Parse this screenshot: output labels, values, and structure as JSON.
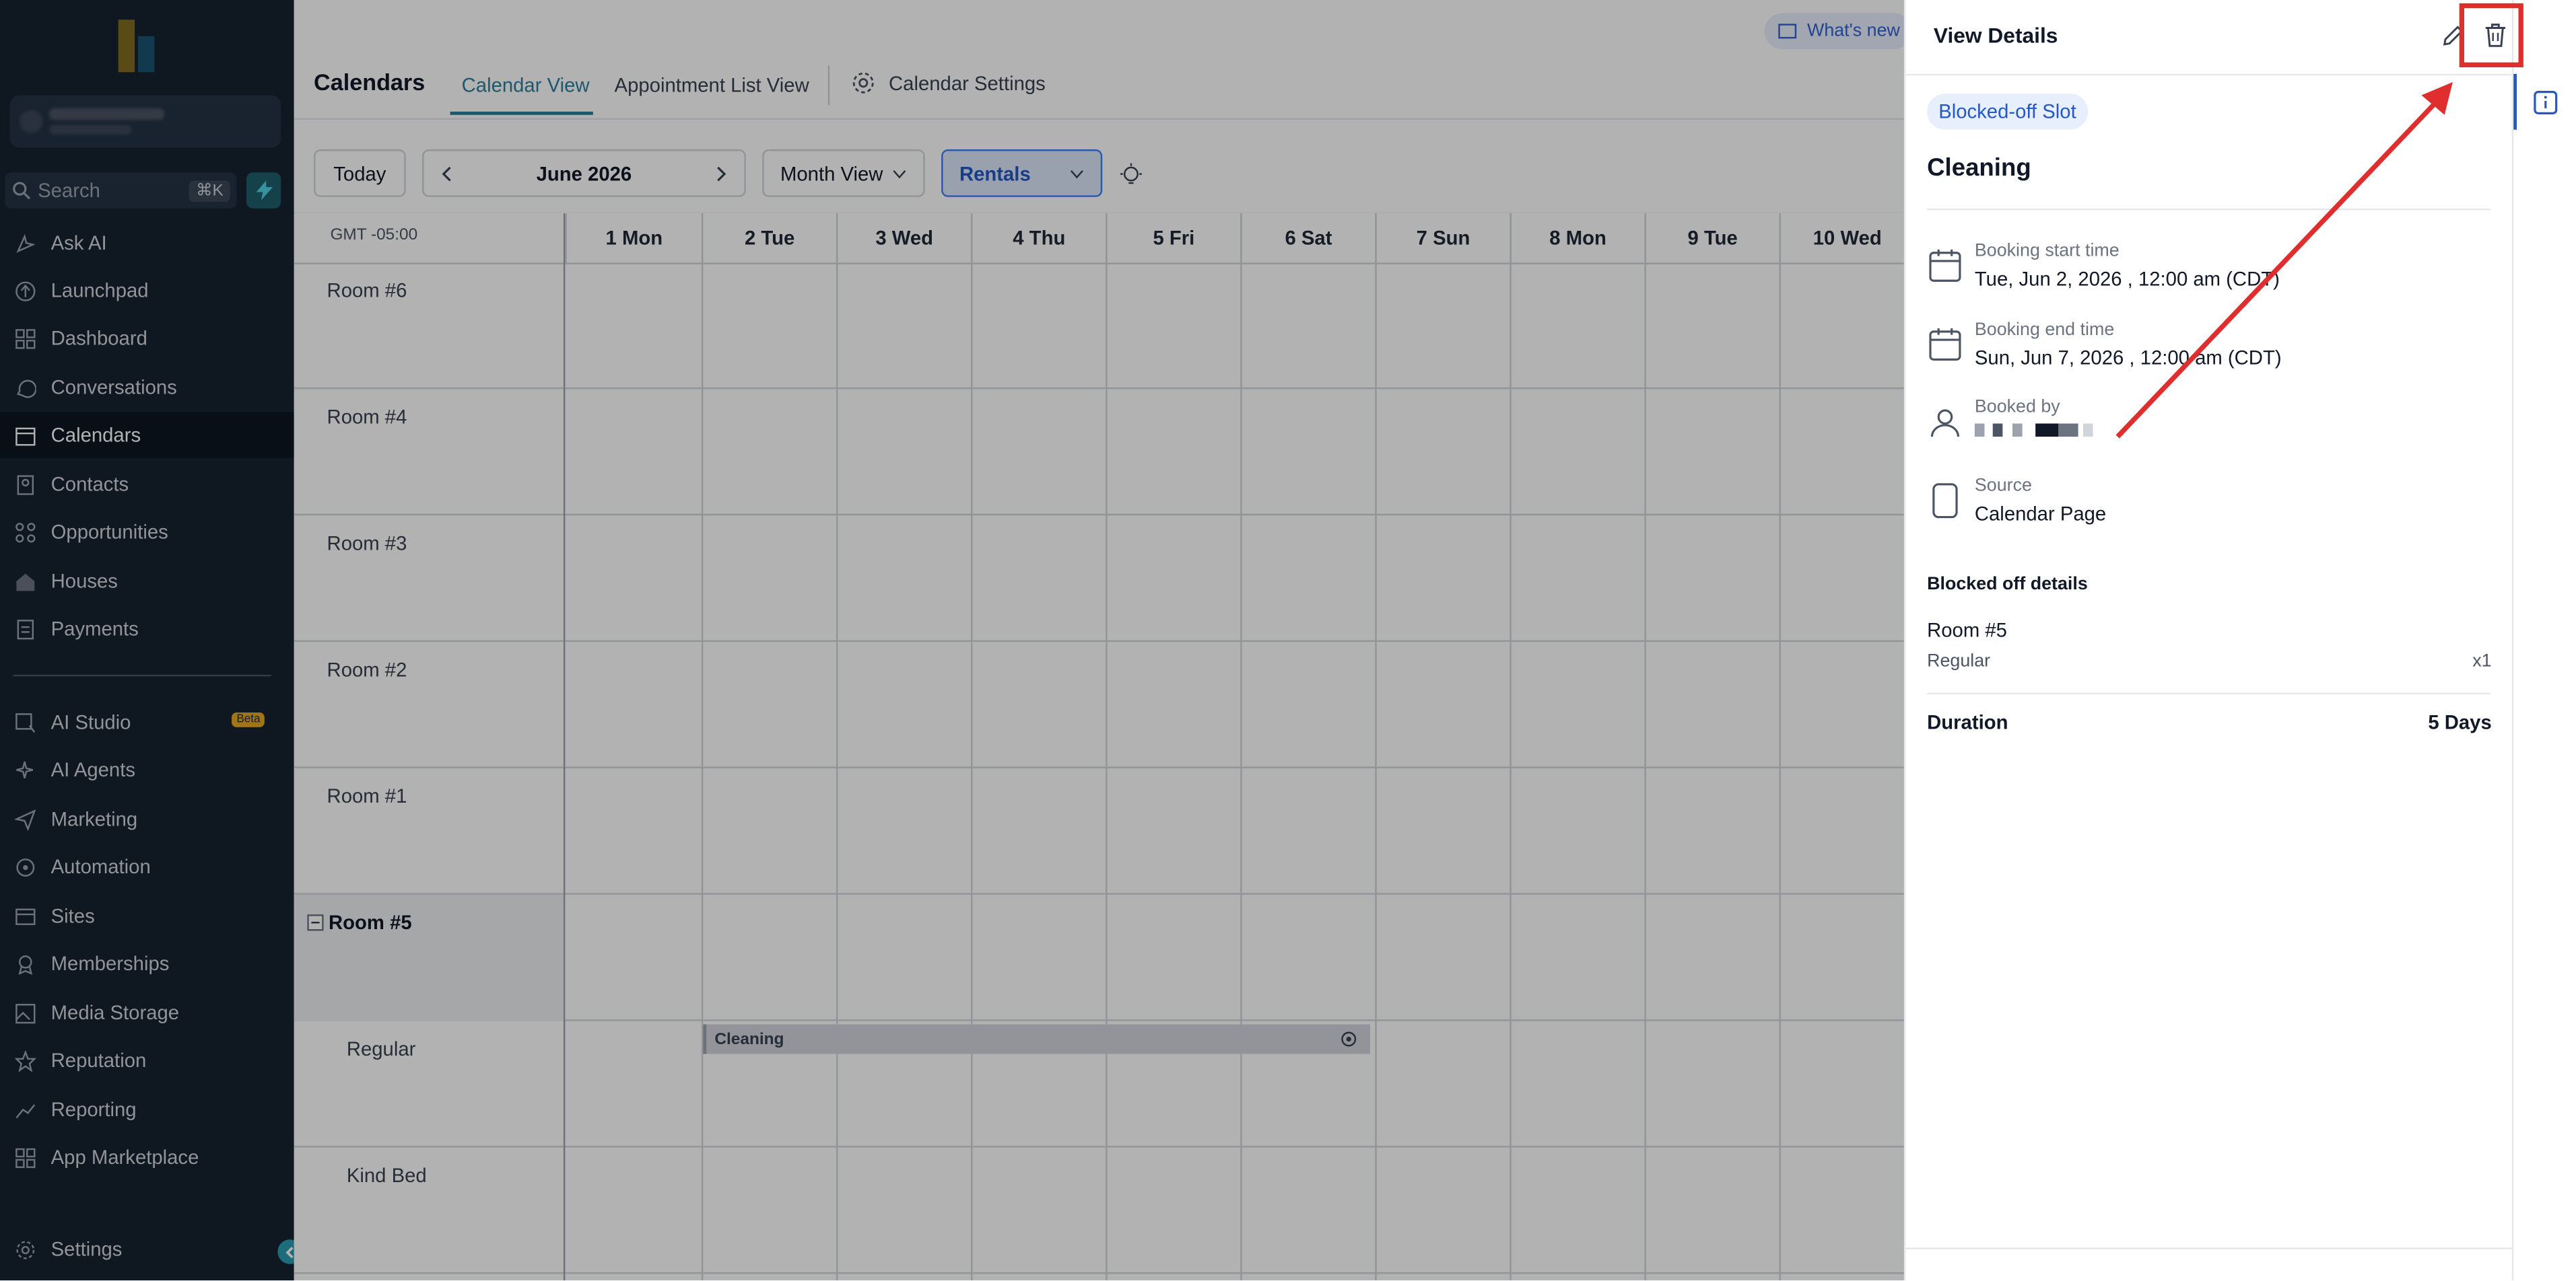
{
  "sidebar": {
    "search": {
      "placeholder": "Search",
      "shortcut": "⌘K"
    },
    "items": [
      {
        "label": "Ask AI",
        "icon": "ask-ai-icon"
      },
      {
        "label": "Launchpad",
        "icon": "launchpad-icon"
      },
      {
        "label": "Dashboard",
        "icon": "dashboard-icon"
      },
      {
        "label": "Conversations",
        "icon": "chat-icon"
      },
      {
        "label": "Calendars",
        "icon": "calendar-icon",
        "active": true
      },
      {
        "label": "Contacts",
        "icon": "contacts-icon"
      },
      {
        "label": "Opportunities",
        "icon": "opportunities-icon"
      },
      {
        "label": "Houses",
        "icon": "house-icon"
      },
      {
        "label": "Payments",
        "icon": "payments-icon"
      },
      {
        "label": "AI Studio",
        "icon": "ai-studio-icon",
        "badge": "Beta"
      },
      {
        "label": "AI Agents",
        "icon": "ai-agents-icon"
      },
      {
        "label": "Marketing",
        "icon": "marketing-icon"
      },
      {
        "label": "Automation",
        "icon": "automation-icon"
      },
      {
        "label": "Sites",
        "icon": "sites-icon"
      },
      {
        "label": "Memberships",
        "icon": "memberships-icon"
      },
      {
        "label": "Media Storage",
        "icon": "media-icon"
      },
      {
        "label": "Reputation",
        "icon": "reputation-icon"
      },
      {
        "label": "Reporting",
        "icon": "reporting-icon"
      },
      {
        "label": "App Marketplace",
        "icon": "marketplace-icon"
      },
      {
        "label": "Settings",
        "icon": "gear-icon"
      }
    ]
  },
  "header": {
    "title": "Calendars",
    "tabs": [
      "Calendar View",
      "Appointment List View",
      "Calendar Settings"
    ],
    "whats_new": "What's new"
  },
  "toolbar": {
    "today": "Today",
    "month_label": "June 2026",
    "view": "Month View",
    "calendar": "Rentals"
  },
  "calendar": {
    "timezone": "GMT -05:00",
    "columns": [
      "1 Mon",
      "2 Tue",
      "3 Wed",
      "4 Thu",
      "5 Fri",
      "6 Sat",
      "7 Sun",
      "8 Mon",
      "9 Tue",
      "10 Wed"
    ],
    "rows": [
      "Room #6",
      "Room #4",
      "Room #3",
      "Room #2",
      "Room #1",
      "Room #5",
      "Regular",
      "Kind Bed"
    ],
    "event": {
      "title": "Cleaning"
    }
  },
  "panel": {
    "title": "View Details",
    "tag": "Blocked-off Slot",
    "name": "Cleaning",
    "start_label": "Booking start time",
    "start_value": "Tue, Jun 2, 2026 , 12:00 am (CDT)",
    "end_label": "Booking end time",
    "end_value": "Sun, Jun 7, 2026 , 12:00 am (CDT)",
    "booked_by_label": "Booked by",
    "source_label": "Source",
    "source_value": "Calendar Page",
    "blocked_title": "Blocked off details",
    "room": "Room #5",
    "room_type": "Regular",
    "qty": "x1",
    "duration_label": "Duration",
    "duration_value": "5 Days"
  },
  "annotation": {
    "color": "#e02d2d"
  }
}
